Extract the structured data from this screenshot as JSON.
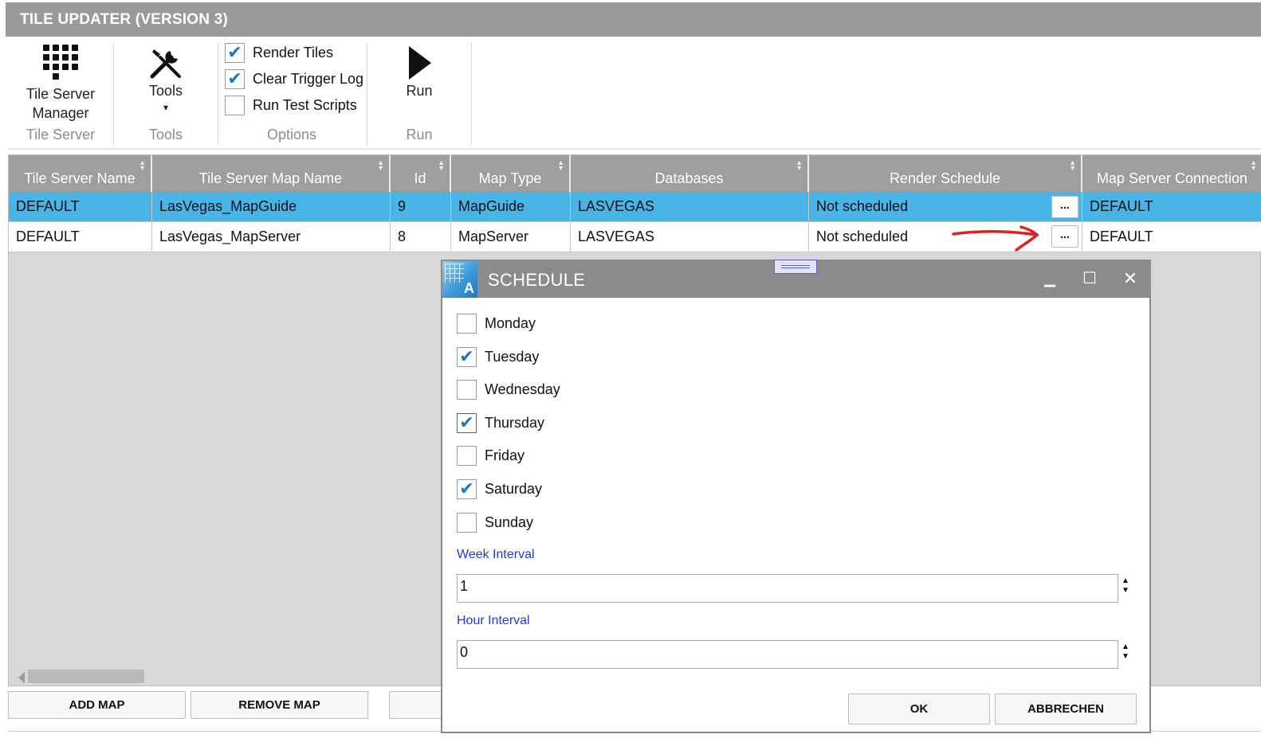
{
  "app": {
    "title": "TILE UPDATER (VERSION 3)"
  },
  "ribbon": {
    "tile_server_group": {
      "button_label_line1": "Tile Server",
      "button_label_line2": "Manager",
      "group_label": "Tile Server",
      "icon": "keypad-grid-icon"
    },
    "tools_group": {
      "button_label": "Tools",
      "dropdown_glyph": "▾",
      "group_label": "Tools",
      "icon": "wrench-screwdriver-icon"
    },
    "options_group": {
      "group_label": "Options",
      "options": [
        {
          "label": "Render Tiles",
          "checked": true
        },
        {
          "label": "Clear Trigger Log",
          "checked": true
        },
        {
          "label": "Run Test Scripts",
          "checked": false
        }
      ]
    },
    "run_group": {
      "button_label": "Run",
      "group_label": "Run",
      "icon": "play-triangle-icon"
    }
  },
  "grid": {
    "columns": [
      "Tile Server Name",
      "Tile Server Map Name",
      "Id",
      "Map Type",
      "Databases",
      "Render Schedule",
      "Map Server Connection"
    ],
    "rows": [
      {
        "tile_server_name": "DEFAULT",
        "map_name": "LasVegas_MapGuide",
        "id": "9",
        "map_type": "MapGuide",
        "databases": "LASVEGAS",
        "render_schedule": "Not scheduled",
        "schedule_button": "...",
        "connection": "DEFAULT",
        "selected": true
      },
      {
        "tile_server_name": "DEFAULT",
        "map_name": "LasVegas_MapServer",
        "id": "8",
        "map_type": "MapServer",
        "databases": "LASVEGAS",
        "render_schedule": "Not scheduled",
        "schedule_button": "...",
        "connection": "DEFAULT",
        "selected": false
      }
    ]
  },
  "bottom_buttons": {
    "add_map": "ADD MAP",
    "remove_map": "REMOVE MAP"
  },
  "dialog": {
    "title": "SCHEDULE",
    "logo_letter": "A",
    "window_controls": {
      "minimize": "▁",
      "maximize": "☐",
      "close": "✕"
    },
    "days": [
      {
        "label": "Monday",
        "checked": false
      },
      {
        "label": "Tuesday",
        "checked": true
      },
      {
        "label": "Wednesday",
        "checked": false
      },
      {
        "label": "Thursday",
        "checked": true
      },
      {
        "label": "Friday",
        "checked": false
      },
      {
        "label": "Saturday",
        "checked": true
      },
      {
        "label": "Sunday",
        "checked": false
      }
    ],
    "week_interval": {
      "label": "Week Interval",
      "value": "1"
    },
    "hour_interval": {
      "label": "Hour Interval",
      "value": "0"
    },
    "ok_label": "OK",
    "cancel_label": "ABBRECHEN"
  },
  "colors": {
    "title_bar": "#9a9a9a",
    "selected_row": "#49b4e6",
    "check": "#1a78c2",
    "field_label": "#1e3cc9",
    "annotation_arrow": "#e02020"
  }
}
